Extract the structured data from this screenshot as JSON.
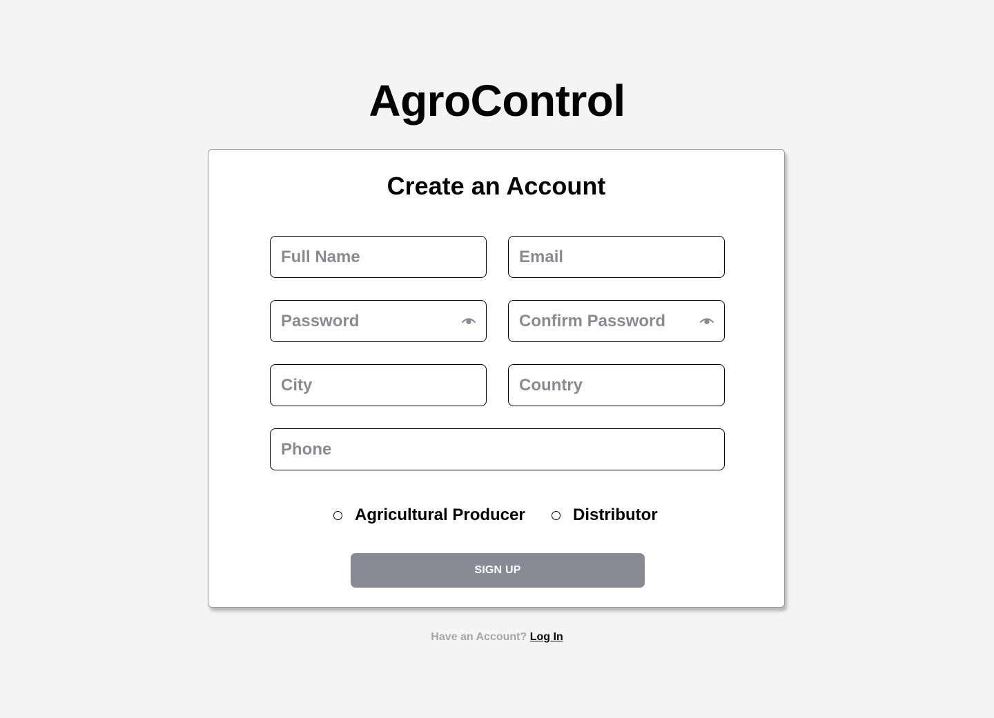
{
  "app": {
    "title": "AgroControl"
  },
  "card": {
    "title": "Create an Account"
  },
  "form": {
    "full_name": {
      "value": "",
      "placeholder": "Full Name"
    },
    "email": {
      "value": "",
      "placeholder": "Email"
    },
    "password": {
      "value": "",
      "placeholder": "Password"
    },
    "confirm_password": {
      "value": "",
      "placeholder": "Confirm Password"
    },
    "city": {
      "value": "",
      "placeholder": "City"
    },
    "country": {
      "value": "",
      "placeholder": "Country"
    },
    "phone": {
      "value": "",
      "placeholder": "Phone"
    }
  },
  "roles": {
    "producer_label": "Agricultural Producer",
    "distributor_label": "Distributor",
    "selected": ""
  },
  "buttons": {
    "signup_label": "SIGN UP"
  },
  "footer": {
    "prompt": "Have an Account?",
    "login_label": "Log In"
  },
  "icons": {
    "password_toggle": "eye-icon",
    "confirm_password_toggle": "eye-icon"
  },
  "colors": {
    "background": "#f4f4f4",
    "card": "#ffffff",
    "button": "#8a8a94",
    "placeholder": "#8a8a92",
    "footer_text": "#a6a6a6"
  }
}
